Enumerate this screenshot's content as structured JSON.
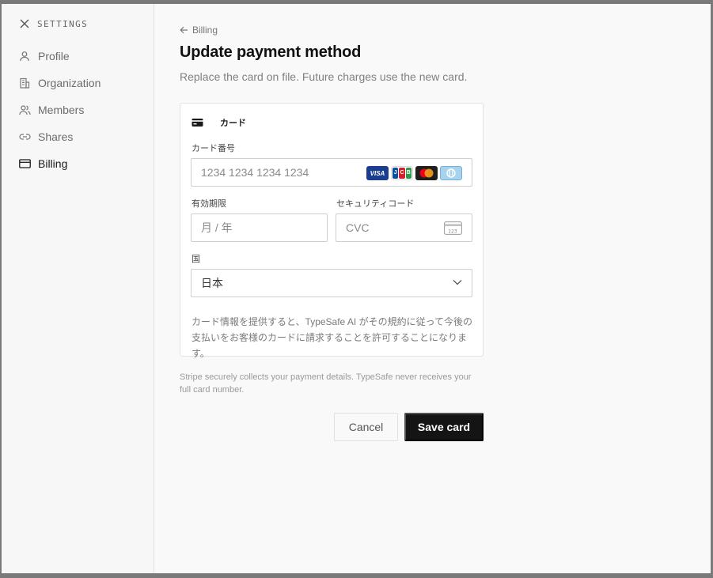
{
  "sidebar": {
    "title": "SETTINGS",
    "items": [
      {
        "label": "Profile",
        "icon": "user-icon",
        "active": false
      },
      {
        "label": "Organization",
        "icon": "building-icon",
        "active": false
      },
      {
        "label": "Members",
        "icon": "users-icon",
        "active": false
      },
      {
        "label": "Shares",
        "icon": "link-icon",
        "active": false
      },
      {
        "label": "Billing",
        "icon": "credit-card-icon",
        "active": true
      }
    ]
  },
  "main": {
    "back_label": "Billing",
    "title": "Update payment method",
    "subtitle": "Replace the card on file. Future charges use the new card."
  },
  "payment_form": {
    "tab_label": "カード",
    "card_number": {
      "label": "カード番号",
      "placeholder": "1234 1234 1234 1234",
      "value": ""
    },
    "card_brands": [
      "VISA",
      "JCB",
      "Mastercard",
      "Diners"
    ],
    "expiry": {
      "label": "有効期限",
      "placeholder": "月 / 年",
      "value": ""
    },
    "cvc": {
      "label": "セキュリティコード",
      "placeholder": "CVC",
      "value": "",
      "icon_text": "123"
    },
    "country": {
      "label": "国",
      "value": "日本"
    },
    "terms": "カード情報を提供すると、TypeSafe AI がその規約に従って今後の支払いをお客様のカードに請求することを許可することになります。"
  },
  "secure_note": "Stripe securely collects your payment details. TypeSafe never receives your full card number.",
  "actions": {
    "cancel_label": "Cancel",
    "save_label": "Save card"
  },
  "colors": {
    "primary_button": "#141414",
    "background": "#f9f9f9",
    "visa": "#1a3e8f",
    "jcb_blue": "#0b4ea2",
    "jcb_red": "#d3202f",
    "jcb_green": "#2a9b47"
  }
}
